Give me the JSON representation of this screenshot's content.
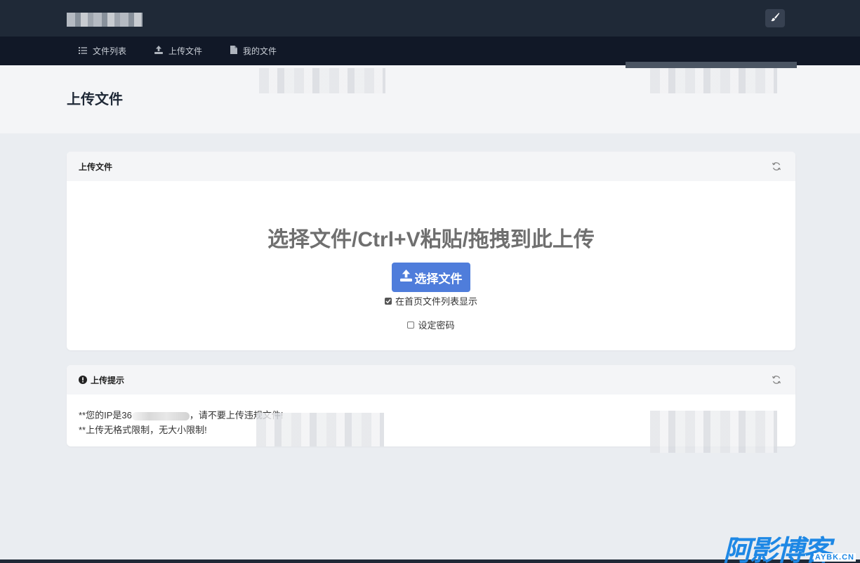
{
  "nav": {
    "items": [
      {
        "label": "文件列表",
        "icon": "list-icon"
      },
      {
        "label": "上传文件",
        "icon": "upload-icon"
      },
      {
        "label": "我的文件",
        "icon": "file-icon"
      }
    ]
  },
  "page": {
    "title": "上传文件"
  },
  "upload_card": {
    "header": "上传文件",
    "heading": "选择文件/Ctrl+V粘贴/拖拽到此上传",
    "choose_button": "选择文件",
    "show_on_home": {
      "label": "在首页文件列表显示",
      "checked": true
    },
    "set_password": {
      "label": "设定密码",
      "checked": false
    }
  },
  "hint_card": {
    "header": "上传提示",
    "line1_prefix": "**您的IP是36",
    "line1_suffix": "，请不要上传违规文件!",
    "line2": "**上传无格式限制，无大小限制!"
  },
  "watermark": {
    "main": "阿影博客",
    "sub": "AYBK.CN"
  },
  "colors": {
    "header_bg": "#1f2937",
    "nav_bg": "#111827",
    "primary_button": "#4f7ddb",
    "page_bg": "#eaedf1"
  }
}
